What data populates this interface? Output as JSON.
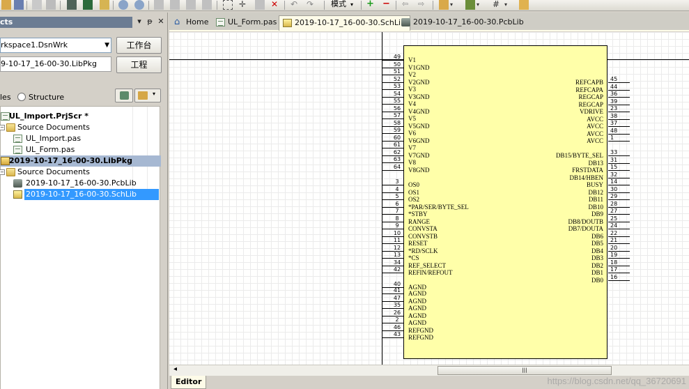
{
  "toolbar": {
    "mode_label": "模式"
  },
  "panel": {
    "title": "cts",
    "workspace": "rkspace1.DsnWrk",
    "workspace_button": "工作台",
    "project": "9-10-17_16-00-30.LibPkg",
    "project_button": "工程",
    "view_files": "les",
    "view_structure": "Structure",
    "tree": [
      "UL_Import.PrjScr *",
      "Source Documents",
      "UL_Import.pas",
      "UL_Form.pas",
      "2019-10-17_16-00-30.LibPkg",
      "Source Documents",
      "2019-10-17_16-00-30.PcbLib",
      "2019-10-17_16-00-30.SchLib"
    ]
  },
  "tabs": [
    {
      "label": "Home"
    },
    {
      "label": "UL_Form.pas"
    },
    {
      "label": "2019-10-17_16-00-30.SchLib"
    },
    {
      "label": "2019-10-17_16-00-30.PcbLib"
    }
  ],
  "editor_tab": "Editor",
  "watermark": "https://blog.csdn.net/qq_36720691",
  "colors": {
    "part_body": "#ffffa9",
    "selection": "#3399ff",
    "canvas": "#fffffe"
  },
  "component": {
    "left_pins": [
      {
        "num": "49",
        "name": "V1"
      },
      {
        "num": "50",
        "name": "V1GND"
      },
      {
        "num": "51",
        "name": "V2"
      },
      {
        "num": "52",
        "name": "V2GND"
      },
      {
        "num": "53",
        "name": "V3"
      },
      {
        "num": "54",
        "name": "V3GND"
      },
      {
        "num": "55",
        "name": "V4"
      },
      {
        "num": "56",
        "name": "V4GND"
      },
      {
        "num": "57",
        "name": "V5"
      },
      {
        "num": "58",
        "name": "V5GND"
      },
      {
        "num": "59",
        "name": "V6"
      },
      {
        "num": "60",
        "name": "V6GND"
      },
      {
        "num": "61",
        "name": "V7"
      },
      {
        "num": "62",
        "name": "V7GND"
      },
      {
        "num": "63",
        "name": "V8"
      },
      {
        "num": "64",
        "name": "V8GND"
      },
      {
        "num": "3",
        "name": "OS0"
      },
      {
        "num": "4",
        "name": "OS1"
      },
      {
        "num": "5",
        "name": "OS2"
      },
      {
        "num": "6",
        "name": "*PAR/SER/BYTE_SEL"
      },
      {
        "num": "7",
        "name": "*STBY"
      },
      {
        "num": "8",
        "name": "RANGE"
      },
      {
        "num": "9",
        "name": "CONVSTA"
      },
      {
        "num": "10",
        "name": "CONVSTB"
      },
      {
        "num": "11",
        "name": "RESET"
      },
      {
        "num": "12",
        "name": "*RD/SCLK"
      },
      {
        "num": "13",
        "name": "*CS"
      },
      {
        "num": "34",
        "name": "REF_SELECT"
      },
      {
        "num": "42",
        "name": "REFIN/REFOUT"
      },
      {
        "num": "40",
        "name": "AGND"
      },
      {
        "num": "41",
        "name": "AGND"
      },
      {
        "num": "47",
        "name": "AGND"
      },
      {
        "num": "35",
        "name": "AGND"
      },
      {
        "num": "26",
        "name": "AGND"
      },
      {
        "num": "2",
        "name": "AGND"
      },
      {
        "num": "46",
        "name": "REFGND"
      },
      {
        "num": "43",
        "name": "REFGND"
      }
    ],
    "right_pins": [
      {
        "num": "45",
        "name": "REFCAPB"
      },
      {
        "num": "44",
        "name": "REFCAPA"
      },
      {
        "num": "36",
        "name": "REGCAP"
      },
      {
        "num": "39",
        "name": "REGCAP"
      },
      {
        "num": "23",
        "name": "VDRIVE"
      },
      {
        "num": "38",
        "name": "AVCC"
      },
      {
        "num": "37",
        "name": "AVCC"
      },
      {
        "num": "48",
        "name": "AVCC"
      },
      {
        "num": "1",
        "name": "AVCC"
      },
      {
        "num": "33",
        "name": "DB15/BYTE_SEL"
      },
      {
        "num": "31",
        "name": "DB13"
      },
      {
        "num": "15",
        "name": "FRSTDATA"
      },
      {
        "num": "32",
        "name": "DB14/HBEN"
      },
      {
        "num": "14",
        "name": "BUSY"
      },
      {
        "num": "30",
        "name": "DB12"
      },
      {
        "num": "29",
        "name": "DB11"
      },
      {
        "num": "28",
        "name": "DB10"
      },
      {
        "num": "27",
        "name": "DB9"
      },
      {
        "num": "25",
        "name": "DB8/DOUTB"
      },
      {
        "num": "24",
        "name": "DB7/DOUTA"
      },
      {
        "num": "22",
        "name": "DB6"
      },
      {
        "num": "21",
        "name": "DB5"
      },
      {
        "num": "20",
        "name": "DB4"
      },
      {
        "num": "19",
        "name": "DB3"
      },
      {
        "num": "18",
        "name": "DB2"
      },
      {
        "num": "17",
        "name": "DB1"
      },
      {
        "num": "16",
        "name": "DB0"
      }
    ]
  }
}
